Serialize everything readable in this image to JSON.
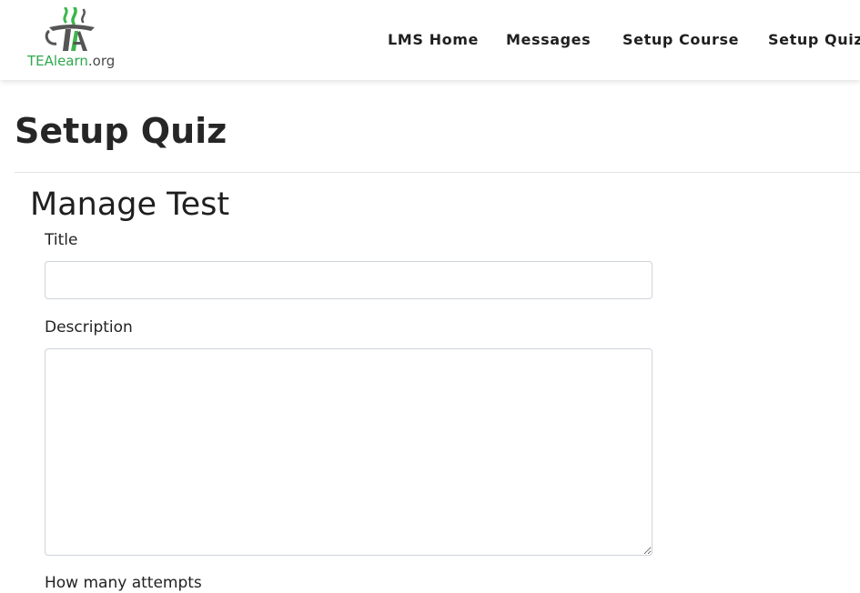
{
  "header": {
    "logo": {
      "icon": "teacup-logo-icon",
      "text_brand": "TEAlearn",
      "text_suffix": ".org",
      "colors": {
        "brand_green": "#2fa84f",
        "steam_green": "#3cb64a",
        "cup_gray": "#555555"
      }
    },
    "nav": {
      "items": [
        {
          "label": "LMS Home"
        },
        {
          "label": "Messages"
        },
        {
          "label": "Setup Course"
        },
        {
          "label": "Setup Quiz"
        }
      ]
    }
  },
  "page": {
    "title": "Setup Quiz"
  },
  "form": {
    "section_title": "Manage Test",
    "title_field": {
      "label": "Title",
      "value": "",
      "placeholder": ""
    },
    "description_field": {
      "label": "Description",
      "value": "",
      "placeholder": ""
    },
    "attempts_field": {
      "label": "How many attempts"
    }
  }
}
